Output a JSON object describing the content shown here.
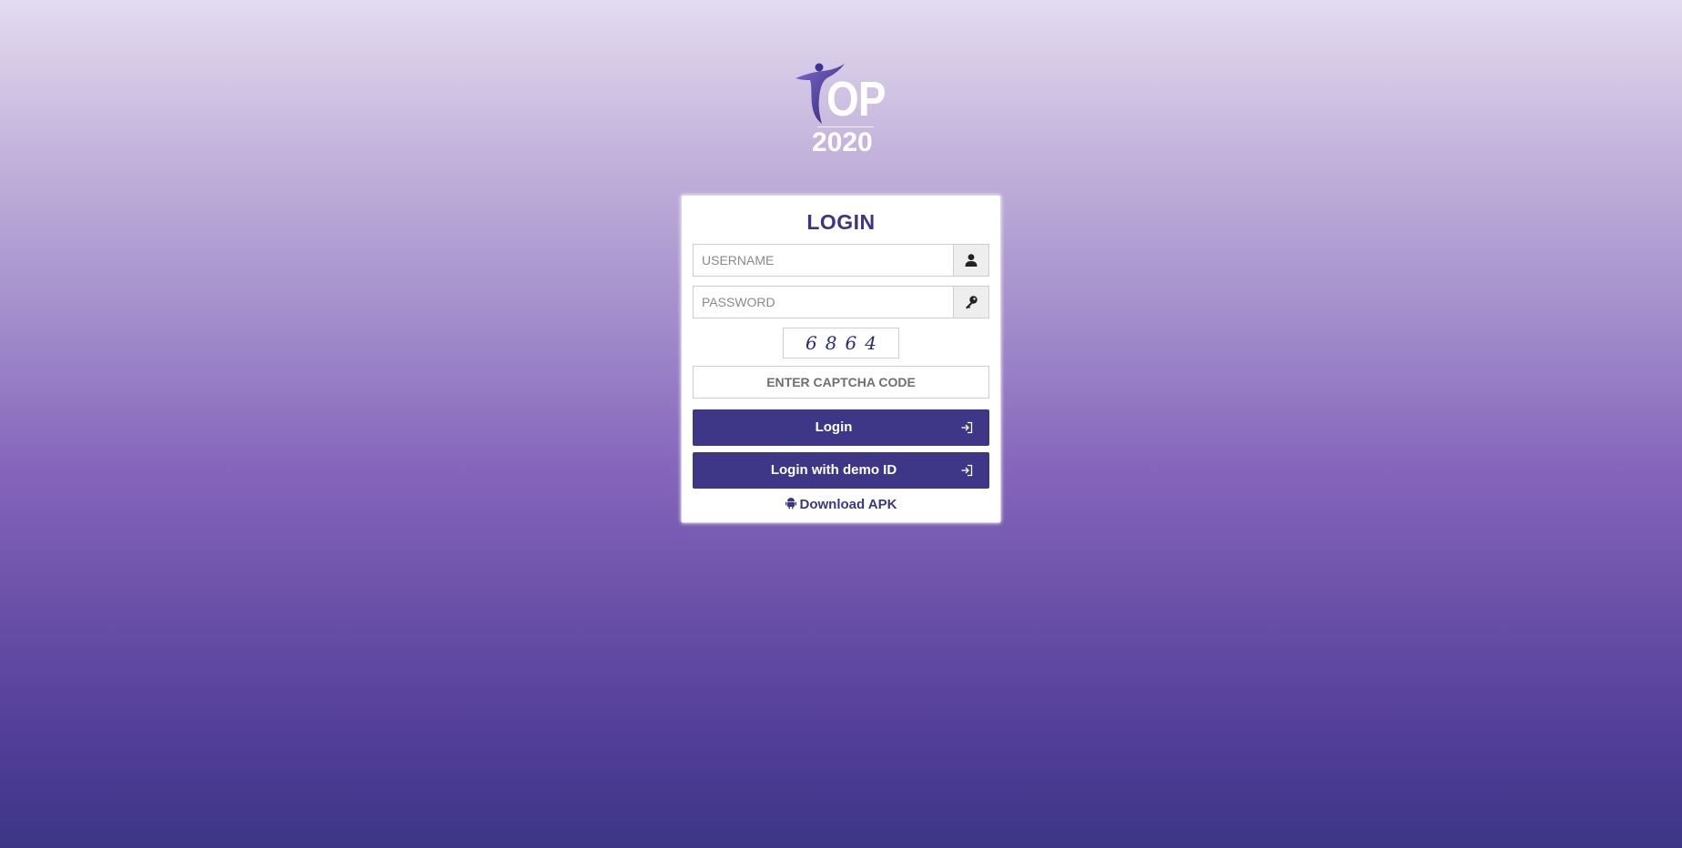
{
  "logo": {
    "name": "OP",
    "year": "2020"
  },
  "login": {
    "title": "LOGIN",
    "username_placeholder": "USERNAME",
    "username_value": "",
    "password_placeholder": "PASSWORD",
    "password_value": "",
    "captcha_code": "6864",
    "captcha_placeholder": "ENTER CAPTCHA CODE",
    "captcha_value": "",
    "login_button": "Login",
    "demo_button": "Login with demo ID",
    "download_apk": "Download APK"
  },
  "icons": {
    "username": "user-icon",
    "password": "key-icon",
    "login": "sign-in-icon",
    "demo": "sign-in-icon",
    "apk": "android-icon"
  },
  "colors": {
    "brand": "#3e3788",
    "title": "#3e3587",
    "captcha_text": "#2e2a7a"
  }
}
